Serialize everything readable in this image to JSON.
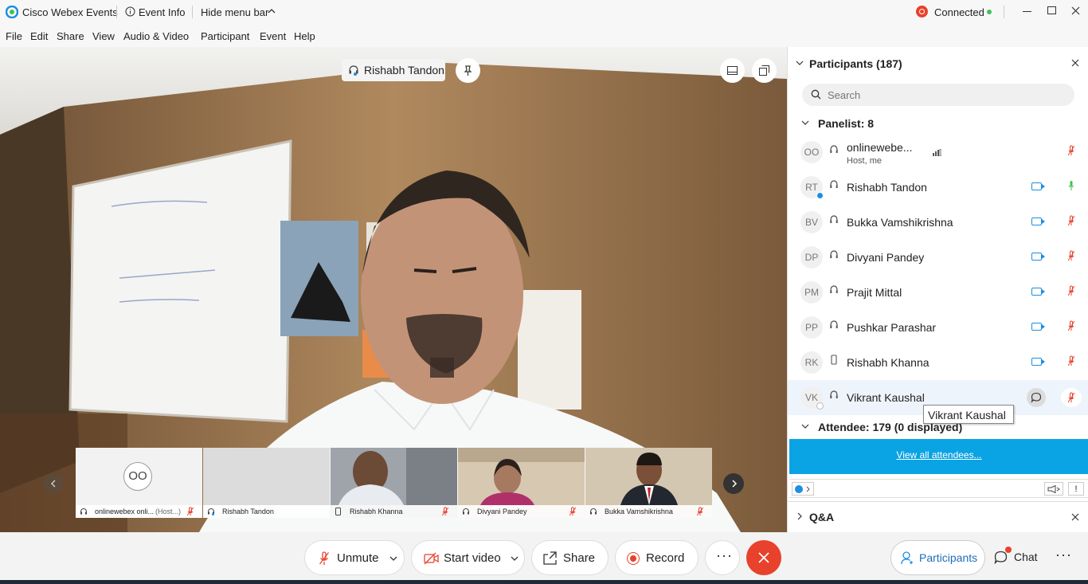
{
  "titlebar": {
    "app_name": "Cisco Webex Events",
    "event_info": "Event Info",
    "hide_menu": "Hide menu bar",
    "status": "Connected"
  },
  "menu": [
    "File",
    "Edit",
    "Share",
    "View",
    "Audio & Video",
    "Participant",
    "Event",
    "Help"
  ],
  "stage": {
    "speaker_name": "Rishabh Tandon",
    "thumbnails": [
      {
        "name": "onlinewebex onli...",
        "role": "(Host...)",
        "initials": "OO"
      },
      {
        "name": "Rishabh Tandon"
      },
      {
        "name": "Rishabh Khanna"
      },
      {
        "name": "Divyani Pandey"
      },
      {
        "name": "Bukka Vamshikrishna"
      }
    ]
  },
  "panel": {
    "title": "Participants (187)",
    "search_placeholder": "Search",
    "panelist_header": "Panelist: 8",
    "panelists": [
      {
        "initials": "OO",
        "name": "onlinewebe...",
        "sub": "Host, me"
      },
      {
        "initials": "RT",
        "name": "Rishabh Tandon"
      },
      {
        "initials": "BV",
        "name": "Bukka Vamshikrishna"
      },
      {
        "initials": "DP",
        "name": "Divyani Pandey"
      },
      {
        "initials": "PM",
        "name": "Prajit Mittal"
      },
      {
        "initials": "PP",
        "name": "Pushkar Parashar"
      },
      {
        "initials": "RK",
        "name": "Rishabh Khanna"
      },
      {
        "initials": "VK",
        "name": "Vikrant Kaushal"
      }
    ],
    "tooltip": "Vikrant Kaushal",
    "attendee_header": "Attendee: 179 (0 displayed)",
    "view_all": "View all attendees...",
    "qa": "Q&A"
  },
  "bottombar": {
    "unmute": "Unmute",
    "start_video": "Start video",
    "share": "Share",
    "record": "Record",
    "participants": "Participants",
    "chat": "Chat"
  },
  "colors": {
    "accent": "#1d8ee0",
    "end": "#e8412c",
    "mute": "#e8412c",
    "banner": "#0aa3e3"
  }
}
